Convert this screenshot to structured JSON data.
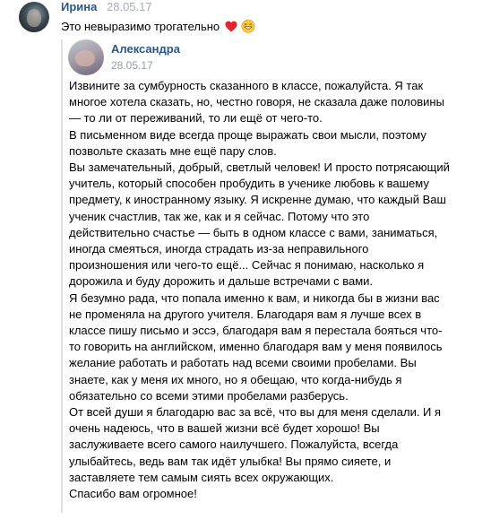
{
  "post": {
    "author": "Ирина",
    "date": "28.05.17",
    "text": "Это невыразимо трогательно",
    "emojis": [
      "red-heart-emoji",
      "grinning-sweat-emoji"
    ]
  },
  "repost": {
    "author": "Александра",
    "date": "28.05.17",
    "lines": [
      "Извините за сумбурность сказанного в классе, пожалуйста. Я так",
      "многое хотела сказать, но, честно говоря, не сказала даже половины",
      "— то ли от переживаний, то ли ещё от чего-то.",
      "В письменном виде всегда проще выражать свои мысли, поэтому",
      "позвольте сказать мне ещё пару слов.",
      "Вы замечательный, добрый, светлый человек! И просто потрясающий",
      "учитель, который способен пробудить в ученике любовь к вашему",
      "предмету, к иностранному языку. Я искренне думаю, что каждый Ваш",
      "ученик счастлив, так же, как и я сейчас. Потому что это",
      "действительно счастье — быть в одном классе с вами, заниматься,",
      "иногда смеяться, иногда страдать из-за неправильного",
      "произношения или чего-то ещё... Сейчас я понимаю, насколько я",
      "дорожила и буду дорожить и дальше встречами с вами.",
      "Я безумно рада, что попала именно к вам, и никогда бы в жизни вас",
      "не променяла на другого учителя. Благодаря вам я лучше всех в",
      "классе пишу письмо и эссэ, благодаря вам я перестала бояться что-",
      "то говорить на английском, именно благодаря вам у меня появилось",
      "желание работать и работать над всеми своими пробелами. Вы",
      "знаете, как у меня их много, но я обещаю, что когда-нибудь я",
      "обязательно со всеми этими пробелами разберусь.",
      "От всей души я благодарю вас за всё, что вы для меня сделали. И я",
      "очень надеюсь, что в вашей жизни всё будет хорошо! Вы",
      "заслуживаете всего самого наилучшего. Пожалуйста, всегда",
      "улыбайтесь, ведь вам так идёт улыбка! Вы прямо сияете, и",
      "заставляете тем самым сиять всех окружающих.",
      "Спасибо вам огромное!"
    ]
  },
  "colors": {
    "link": "#2a5885",
    "date": "#a6afb8",
    "quote_bar": "#dfe3e8",
    "heart": "#e3242b"
  }
}
